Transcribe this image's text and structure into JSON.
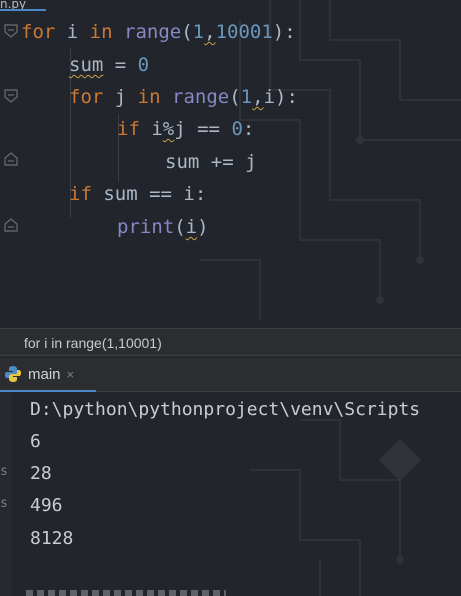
{
  "file_tab": {
    "label": "n.py"
  },
  "editor": {
    "lines": [
      {
        "indent": 0,
        "tokens": [
          [
            "kw",
            "for"
          ],
          [
            "var",
            " i "
          ],
          [
            "kw",
            "in"
          ],
          [
            "var",
            " "
          ],
          [
            "fn",
            "range"
          ],
          [
            "var",
            "("
          ],
          [
            "num",
            "1"
          ],
          [
            "var",
            ","
          ],
          [
            "num",
            "10001"
          ],
          [
            "var",
            "):"
          ]
        ]
      },
      {
        "indent": 1,
        "tokens": [
          [
            "var",
            "sum"
          ],
          [
            "var",
            " = "
          ],
          [
            "num",
            "0"
          ]
        ]
      },
      {
        "indent": 1,
        "tokens": [
          [
            "kw",
            "for"
          ],
          [
            "var",
            " j "
          ],
          [
            "kw",
            "in"
          ],
          [
            "var",
            " "
          ],
          [
            "fn",
            "range"
          ],
          [
            "var",
            "("
          ],
          [
            "num",
            "1"
          ],
          [
            "var",
            ","
          ],
          [
            "var",
            "i"
          ],
          [
            "var",
            "):"
          ]
        ]
      },
      {
        "indent": 2,
        "tokens": [
          [
            "kw",
            "if"
          ],
          [
            "var",
            " i"
          ],
          [
            "var",
            "%"
          ],
          [
            "var",
            "j == "
          ],
          [
            "num",
            "0"
          ],
          [
            "var",
            ":"
          ]
        ]
      },
      {
        "indent": 3,
        "tokens": [
          [
            "var",
            "sum += j"
          ]
        ]
      },
      {
        "indent": 1,
        "tokens": [
          [
            "kw",
            "if"
          ],
          [
            "var",
            " sum == i:"
          ]
        ]
      },
      {
        "indent": 2,
        "tokens": [
          [
            "fn",
            "print"
          ],
          [
            "var",
            "("
          ],
          [
            "var",
            "i"
          ],
          [
            "var",
            ")"
          ]
        ]
      }
    ]
  },
  "breadcrumb": {
    "text": "for i in range(1,10001)"
  },
  "run_panel": {
    "tab_label": "main",
    "tab_close": "×",
    "output_lines": [
      "D:\\python\\pythonproject\\venv\\Scripts",
      "6",
      "28",
      "496",
      "8128"
    ],
    "gutter_glyphs": [
      "s",
      "s"
    ]
  },
  "colors": {
    "keyword": "#cc7832",
    "builtin": "#8888c6",
    "number": "#6897bb",
    "text": "#a9b7c6",
    "accent": "#4a88c7"
  },
  "icons": [
    "fold-open-icon",
    "fold-close-icon",
    "python-icon",
    "close-icon"
  ]
}
